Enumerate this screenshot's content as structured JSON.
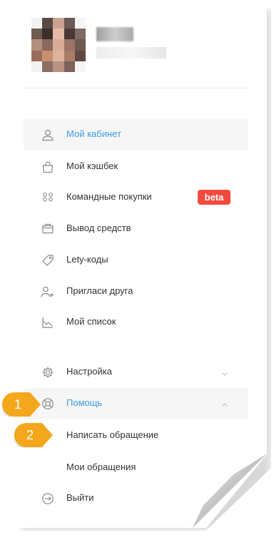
{
  "menu": {
    "items": [
      {
        "label": "Мой кабинет",
        "icon": "user-icon",
        "active": true
      },
      {
        "label": "Мой кэшбек",
        "icon": "shopping-bag-icon"
      },
      {
        "label": "Командные покупки",
        "icon": "group-icon",
        "badge": "beta"
      },
      {
        "label": "Вывод средств",
        "icon": "wallet-icon"
      },
      {
        "label": "Lety-коды",
        "icon": "tag-icon"
      },
      {
        "label": "Пригласи друга",
        "icon": "add-user-icon"
      },
      {
        "label": "Мой список",
        "icon": "chart-icon"
      },
      {
        "label": "Настройка",
        "icon": "gear-icon",
        "expandable": true,
        "expanded": false
      },
      {
        "label": "Помощь",
        "icon": "lifebuoy-icon",
        "expandable": true,
        "expanded": true
      },
      {
        "label": "Выйти",
        "icon": "logout-icon"
      }
    ],
    "help_submenu": [
      {
        "label": "Написать обращение"
      },
      {
        "label": "Мои обращения"
      }
    ]
  },
  "callouts": [
    {
      "number": "1"
    },
    {
      "number": "2"
    }
  ],
  "colors": {
    "active_text": "#3a9be6",
    "badge_bg": "#f24a3c",
    "callout_bg": "#f4a71c",
    "active_bg": "#f6f6f6"
  }
}
